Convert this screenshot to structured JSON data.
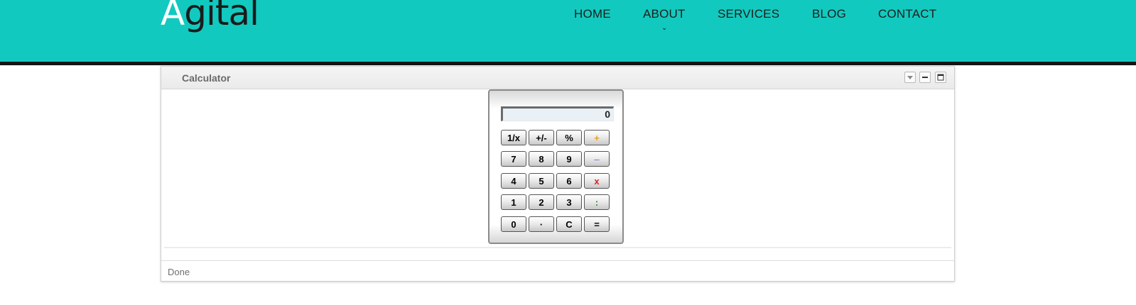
{
  "site": {
    "logo_first": "A",
    "logo_rest": "gital",
    "brand_color": "#12c9bf"
  },
  "nav": {
    "items": [
      {
        "label": "HOME"
      },
      {
        "label": "ABOUT"
      },
      {
        "label": "SERVICES"
      },
      {
        "label": "BLOG"
      },
      {
        "label": "CONTACT"
      }
    ],
    "submenu_indicator": "⌄"
  },
  "portlet": {
    "title": "Calculator",
    "controls": [
      "dropdown-icon",
      "minimize-icon",
      "maximize-icon"
    ],
    "status": "Done"
  },
  "calculator": {
    "display_value": "0",
    "keys": [
      [
        "1/x",
        "+/-",
        "%",
        "+"
      ],
      [
        "7",
        "8",
        "9",
        "–"
      ],
      [
        "4",
        "5",
        "6",
        "x"
      ],
      [
        "1",
        "2",
        "3",
        ":"
      ],
      [
        "0",
        "·",
        "C",
        "="
      ]
    ],
    "operator_colors": {
      "plus": "#e8a317",
      "minus": "#6a6ad0",
      "multiply": "#e02020",
      "divide": "#2e8b2e"
    }
  }
}
